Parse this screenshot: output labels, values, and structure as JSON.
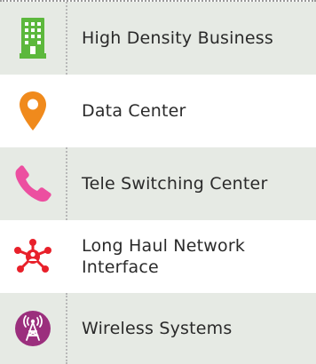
{
  "legend": {
    "items": [
      {
        "label": "High Density Business",
        "icon": "building-icon",
        "color": "#5cb83c"
      },
      {
        "label": "Data Center",
        "icon": "map-pin-icon",
        "color": "#f08a1c"
      },
      {
        "label": "Tele Switching Center",
        "icon": "phone-icon",
        "color": "#ec4fa0"
      },
      {
        "label": "Long Haul Network Interface",
        "icon": "network-hub-icon",
        "color": "#e8202a"
      },
      {
        "label": "Wireless Systems",
        "icon": "wireless-tower-icon",
        "color": "#9b2f7d"
      }
    ]
  }
}
